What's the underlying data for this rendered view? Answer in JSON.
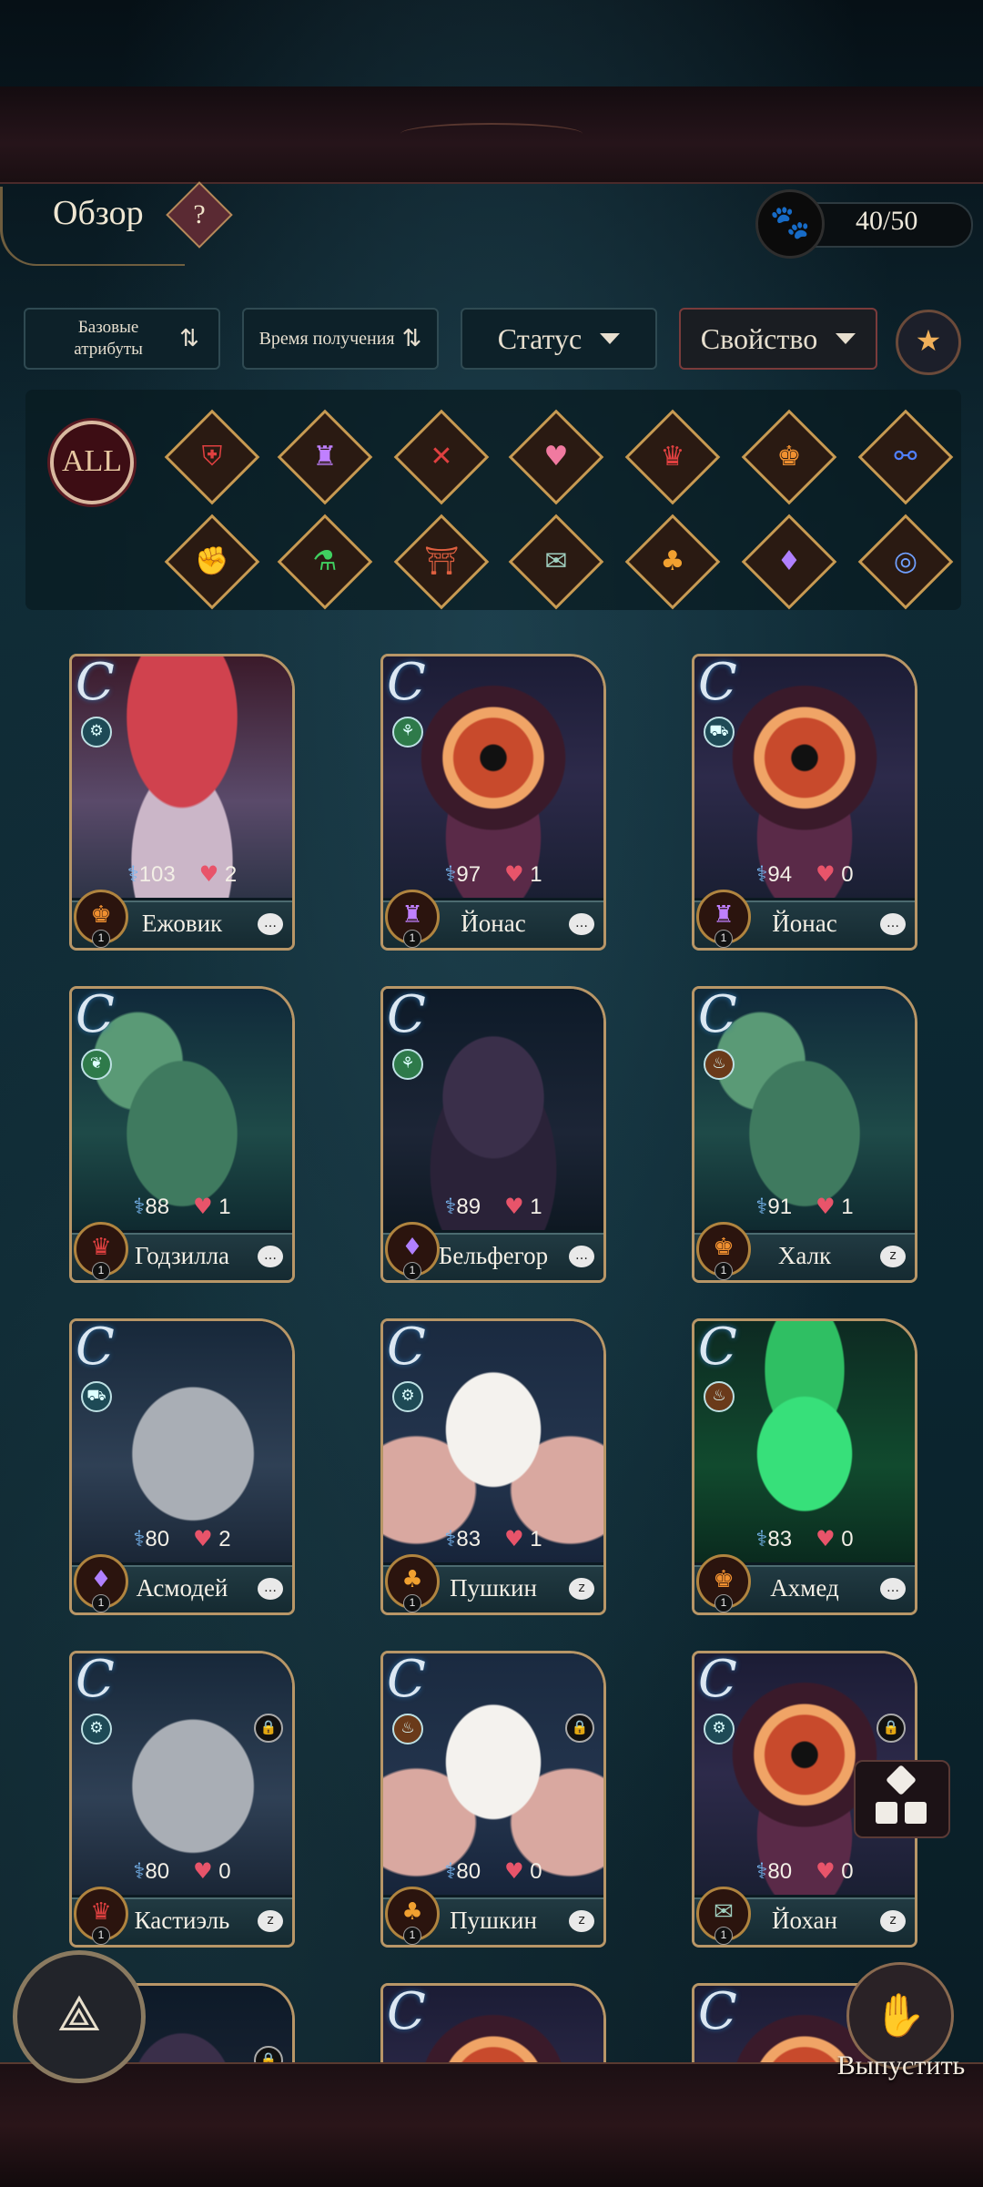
{
  "header": {
    "title": "Обзор",
    "help_label": "?",
    "capacity": "40/50",
    "capacity_icon": "paw-icon"
  },
  "filters": {
    "base_attributes": "Базовые атрибуты",
    "obtain_time": "Время получения",
    "status": "Статус",
    "property": "Свойство"
  },
  "attributes": {
    "all_label": "ALL"
  },
  "cards": [
    {
      "grade": "C",
      "name": "Ежовик",
      "dna": "103",
      "hearts": "2",
      "bubble": "chat"
    },
    {
      "grade": "C",
      "name": "Йонас",
      "dna": "97",
      "hearts": "1",
      "bubble": "chat"
    },
    {
      "grade": "C",
      "name": "Йонас",
      "dna": "94",
      "hearts": "0",
      "bubble": "chat"
    },
    {
      "grade": "C",
      "name": "Годзилла",
      "dna": "88",
      "hearts": "1",
      "bubble": "chat"
    },
    {
      "grade": "C",
      "name": "Бельфегор",
      "dna": "89",
      "hearts": "1",
      "bubble": "chat"
    },
    {
      "grade": "C",
      "name": "Халк",
      "dna": "91",
      "hearts": "1",
      "bubble": "sleep"
    },
    {
      "grade": "C",
      "name": "Асмодей",
      "dna": "80",
      "hearts": "2",
      "bubble": "chat"
    },
    {
      "grade": "C",
      "name": "Пушкин",
      "dna": "83",
      "hearts": "1",
      "bubble": "sleep"
    },
    {
      "grade": "C",
      "name": "Ахмед",
      "dna": "83",
      "hearts": "0",
      "bubble": "chat"
    },
    {
      "grade": "C",
      "name": "Кастиэль",
      "dna": "80",
      "hearts": "0",
      "bubble": "sleep"
    },
    {
      "grade": "C",
      "name": "Пушкин",
      "dna": "80",
      "hearts": "0",
      "bubble": "sleep"
    },
    {
      "grade": "C",
      "name": "Йохан",
      "dna": "80",
      "hearts": "0",
      "bubble": "sleep"
    },
    {
      "grade": "C",
      "name": "",
      "dna": "",
      "hearts": "",
      "bubble": ""
    },
    {
      "grade": "C",
      "name": "",
      "dna": "",
      "hearts": "",
      "bubble": ""
    },
    {
      "grade": "C",
      "name": "",
      "dna": "",
      "hearts": "",
      "bubble": ""
    }
  ],
  "bottom": {
    "release_label": "Выпустить"
  }
}
